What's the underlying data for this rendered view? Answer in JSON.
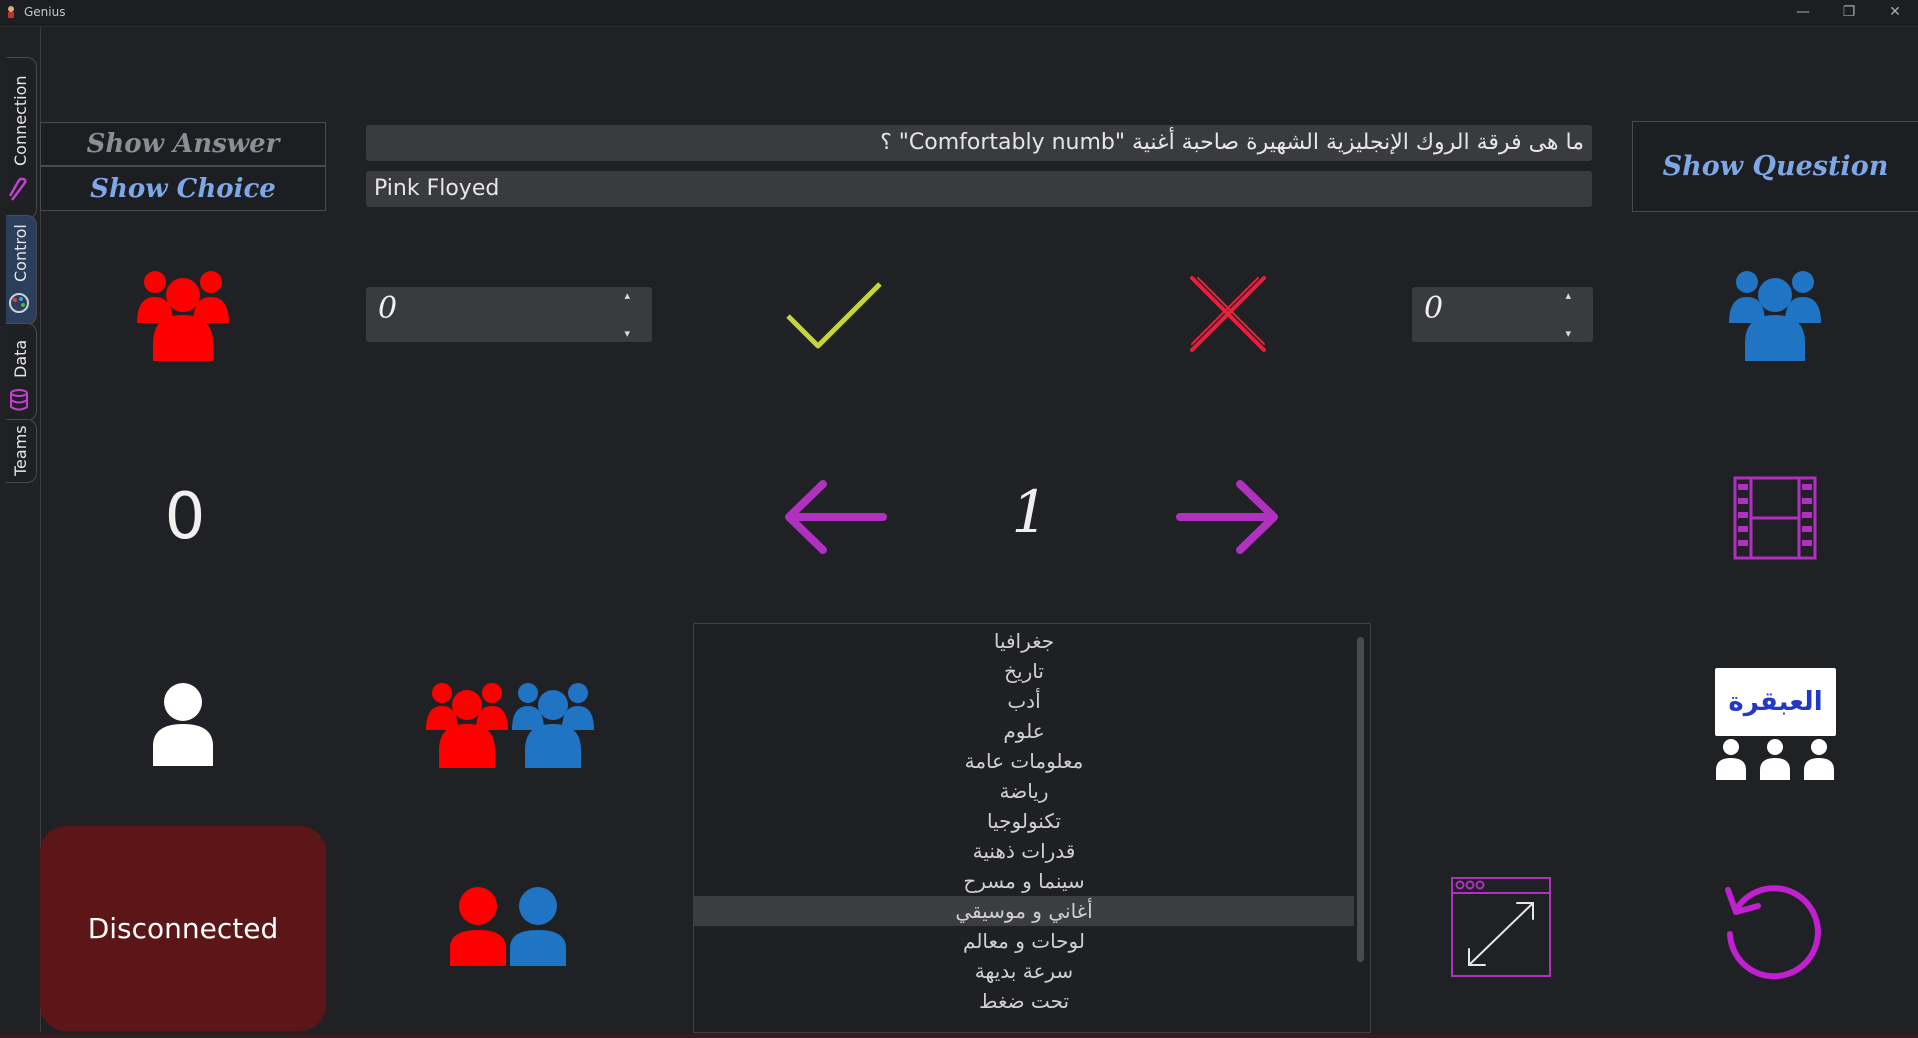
{
  "window": {
    "title": "Genius",
    "minimize_icon": "—",
    "maximize_icon": "❐",
    "close_icon": "✕"
  },
  "tabs": [
    {
      "label": "Connection"
    },
    {
      "label": "Control"
    },
    {
      "label": "Data"
    },
    {
      "label": "Teams"
    }
  ],
  "buttons": {
    "show_answer": "Show Answer",
    "show_choice": "Show Choice",
    "show_question": "Show Question"
  },
  "question": "ما هى فرقة الروك الإنجليزية الشهيرة صاحبة أغنية \"Comfortably numb\" ؟",
  "answer": "Pink Floyed",
  "red_team": {
    "score": "0",
    "color": "#ff0000"
  },
  "blue_team": {
    "score": "0",
    "color": "#1f74c4"
  },
  "spin_arrows": {
    "up": "▴",
    "down": "▾"
  },
  "counter": "0",
  "question_number": "1",
  "categories": [
    "جغرافيا",
    "تاريخ",
    "أدب",
    "علوم",
    "معلومات عامة",
    "رياضة",
    "تكنولوجيا",
    "قدرات ذهنية",
    "سينما و مسرح",
    "أغاني و موسيقي",
    "لوحات و معالم",
    "سرعة بديهة",
    "تحت ضغط"
  ],
  "selected_category": "أغاني و موسيقي",
  "status": "Disconnected",
  "logo_text": "العبقرة",
  "colors": {
    "correct": "#c6d33a",
    "wrong": "#e8203c",
    "accent": "#b030c0",
    "status_bg": "#5c1618",
    "selected_tab": "#2a3f5c"
  }
}
